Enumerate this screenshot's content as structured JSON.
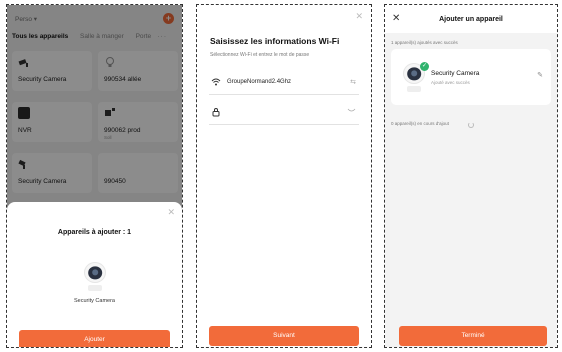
{
  "screen1": {
    "home_name": "Perso ▾",
    "tabs": [
      "Tous les appareils",
      "Salle à manger",
      "Porte"
    ],
    "more": "···",
    "cards": [
      {
        "label": "Security Camera",
        "sub": "",
        "icon": "camera-icon"
      },
      {
        "label": "990534 allée",
        "sub": "",
        "icon": "bulb-icon"
      },
      {
        "label": "NVR",
        "sub": "",
        "icon": "nvr-icon"
      },
      {
        "label": "990062 prod",
        "sub": "Soll",
        "icon": "bulb-icon"
      },
      {
        "label": "Security Camera",
        "sub": "",
        "icon": "camera-icon"
      },
      {
        "label": "990450",
        "sub": "",
        "icon": "bulb-icon"
      }
    ],
    "sheet_title": "Appareils à ajouter : 1",
    "device_label": "Security Camera",
    "add_button": "Ajouter"
  },
  "screen2": {
    "title": "Saisissez les informations Wi-Fi",
    "subtitle": "Sélectionnez Wi-Fi et entrez le mot de passe",
    "wifi_name": "GroupeNormand2.4Ghz",
    "password": "",
    "next_button": "Suivant"
  },
  "screen3": {
    "title": "Ajouter un appareil",
    "added_count": "1 appareil(s) ajoutés avec succès",
    "device_name": "Security Camera",
    "device_status": "Ajouté avec succès",
    "pending_count": "0 appareil(s) en cours d'ajout",
    "done_button": "Terminé"
  },
  "colors": {
    "accent": "#f26b3a",
    "success": "#2fb36d"
  }
}
